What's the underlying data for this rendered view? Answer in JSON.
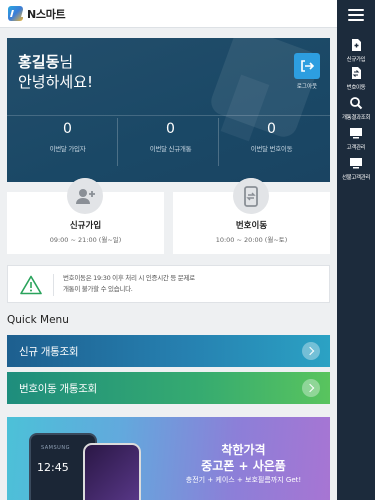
{
  "header": {
    "app_title": "N스마트"
  },
  "rail": {
    "items": [
      {
        "label": "신규가입",
        "icon": "new-doc-icon"
      },
      {
        "label": "번호이동",
        "icon": "number-move-icon"
      },
      {
        "label": "개통결과조회",
        "icon": "search-icon"
      },
      {
        "label": "고객관리",
        "icon": "monitor-icon"
      },
      {
        "label": "선불고객관리",
        "icon": "monitor-icon"
      }
    ]
  },
  "hero": {
    "user_name": "홍길동",
    "name_suffix": "님",
    "greeting": "안녕하세요!",
    "logout_label": "로그아웃",
    "stats": [
      {
        "value": "0",
        "label": "이번달 가입자"
      },
      {
        "value": "0",
        "label": "이번달 신규개통"
      },
      {
        "value": "0",
        "label": "이번달 번호이동"
      }
    ]
  },
  "services": [
    {
      "title": "신규가입",
      "hours": "09:00 ~ 21:00 (월~일)",
      "icon": "add-user-icon"
    },
    {
      "title": "번호이동",
      "hours": "10:00 ~ 20:00 (월~토)",
      "icon": "phone-transfer-icon"
    }
  ],
  "notice": {
    "line1": "번호이동은 19:30 이후 처리 시 인증시간 등 문제로",
    "line2": "개통이 불가할 수 있습니다."
  },
  "quick_menu": {
    "title": "Quick Menu",
    "items": [
      {
        "label": "신규 개통조회"
      },
      {
        "label": "번호이동 개통조회"
      }
    ]
  },
  "banner": {
    "line1": "착한가격",
    "line2": "중고폰 + 사은품",
    "line3": "충전기 + 케이스 + 보호필름까지 Get!",
    "phone_brand": "SAMSUNG",
    "phone_time": "12:45"
  },
  "colors": {
    "rail_bg": "#1c2b3c",
    "hero_bg": "#1a4866",
    "logout_accent": "#2d9ee0"
  }
}
